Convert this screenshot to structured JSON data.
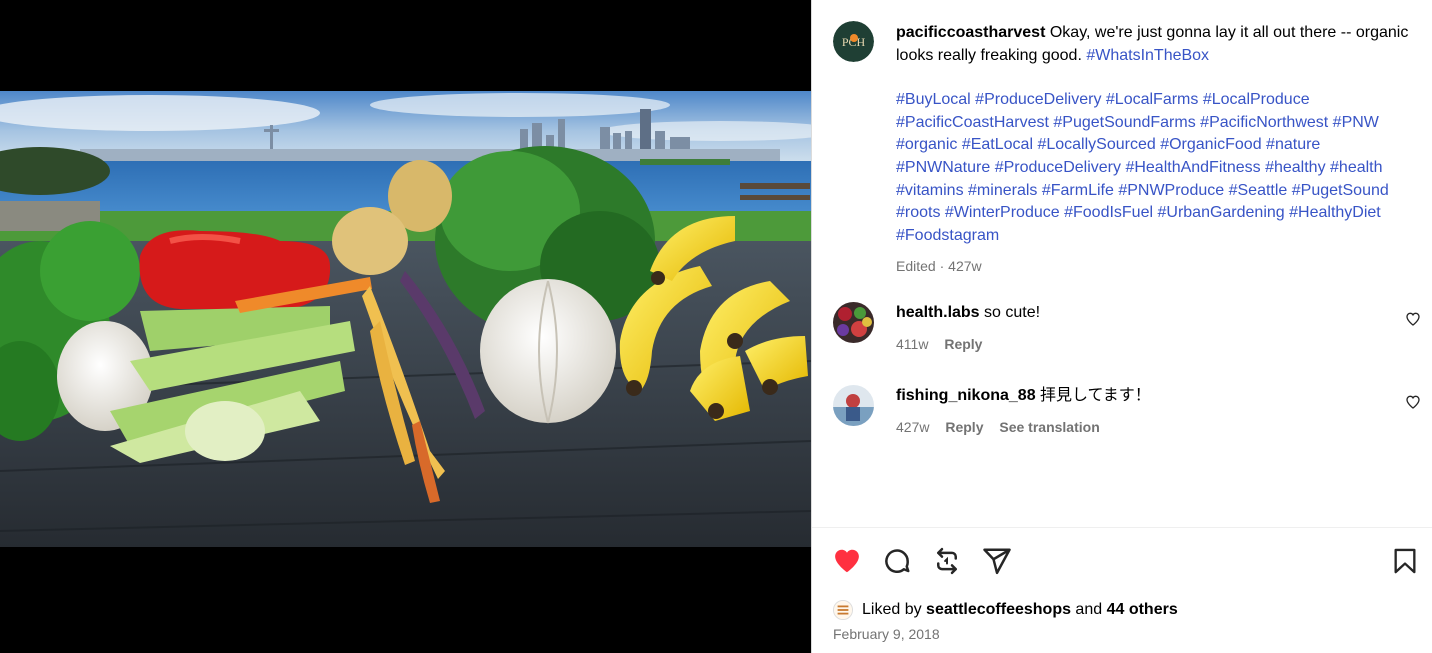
{
  "post": {
    "username": "pacificcoastharvest",
    "avatar_initials": "PCH",
    "caption_text": " Okay, we're just gonna lay it all out there -- organic looks really freaking good. ",
    "caption_tag": "#WhatsInTheBox",
    "hashtags": [
      "#BuyLocal",
      "#ProduceDelivery",
      "#LocalFarms",
      "#LocalProduce",
      "#PacificCoastHarvest",
      "#PugetSoundFarms",
      "#PacificNorthwest",
      "#PNW",
      "#organic",
      "#EatLocal",
      "#LocallySourced",
      "#OrganicFood",
      "#nature",
      "#PNWNature",
      "#ProduceDelivery",
      "#HealthAndFitness",
      "#healthy",
      "#health",
      "#vitamins",
      "#minerals",
      "#FarmLife",
      "#PNWProduce",
      "#Seattle",
      "#PugetSound",
      "#roots",
      "#WinterProduce",
      "#FoodIsFuel",
      "#UrbanGardening",
      "#HealthyDiet",
      "#Foodstagram"
    ],
    "edited_label": "Edited",
    "edited_sep": " · ",
    "age": "427w"
  },
  "comments": [
    {
      "username": "health.labs",
      "text": " so cute!",
      "age": "411w",
      "reply": "Reply"
    },
    {
      "username": "fishing_nikona_88",
      "text": " 拝見してます！",
      "age": "427w",
      "reply": "Reply",
      "translate": "See translation"
    }
  ],
  "likes": {
    "prefix": "Liked by ",
    "user": "seattlecoffeeshops",
    "mid": " and ",
    "others": "44 others"
  },
  "date": "February 9, 2018",
  "colors": {
    "hashtag": "#3854c6",
    "heart": "#ff3040",
    "meta": "#737373",
    "avatar_bg": "#1f3f34"
  },
  "icons": [
    "heart-filled-icon",
    "comment-icon",
    "repost-icon",
    "share-icon",
    "bookmark-icon",
    "heart-outline-icon"
  ]
}
